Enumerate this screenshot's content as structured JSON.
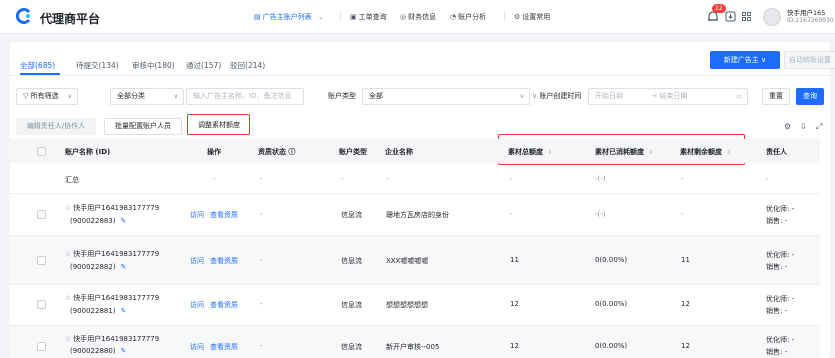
{
  "header": {
    "brand": "代理商平台",
    "nav": [
      {
        "label": "广告主账户列表",
        "icon": "grid-icon",
        "caret": "⌄"
      },
      {
        "label": "工单查询",
        "icon": "ticket-icon"
      },
      {
        "label": "财务信息",
        "icon": "finance-icon"
      },
      {
        "label": "账户分析",
        "icon": "analysis-icon"
      },
      {
        "label": "设置常用",
        "icon": "gear-icon"
      }
    ],
    "badge": "12",
    "user_name": "快手用户165",
    "user_id": "ID:2167369930"
  },
  "tabs": [
    {
      "label": "全部(685)",
      "active": true
    },
    {
      "label": "待提交(134)"
    },
    {
      "label": "审核中(180)"
    },
    {
      "label": "通过(157)"
    },
    {
      "label": "驳回(214)"
    }
  ],
  "actions": {
    "new_advertiser": "新建广告主 ∨",
    "auto_transfer": "自动转账设置"
  },
  "filters": {
    "all_filter": "所有筛选",
    "category": "全部分类",
    "search_placeholder": "输入广告主名称、ID、备注信息",
    "account_type_label": "账户类型",
    "account_type_value": "全部",
    "created_label": "账户创建时间",
    "start_placeholder": "开始日期",
    "end_placeholder": "结束日期",
    "reset": "重置",
    "query": "查询"
  },
  "bulk": {
    "edit_owner": "编辑责任人/协作人",
    "batch_config": "批量配置账户人员",
    "adjust_quota": "调整素材额度"
  },
  "columns": {
    "name": "账户名称 (ID)",
    "ops": "操作",
    "qualification": "资质状态 ⓘ",
    "type": "账户类型",
    "company": "企业名称",
    "total": "素材总额度",
    "used": "素材已消耗额度",
    "remain": "素材剩余额度",
    "owner": "责任人"
  },
  "summary": {
    "label": "汇总",
    "ops": "-",
    "qualification": "-",
    "type": "-",
    "company": "-",
    "total": "-",
    "used": "-(-)",
    "remain": "-",
    "owner": "-"
  },
  "rows": [
    {
      "name": "快手用户1641983177779",
      "id": "(900022883)",
      "ops_visit": "访问",
      "ops_view": "查看资质",
      "qualification": "-",
      "type": "信息流",
      "company": "珊地方瓦房店的身份",
      "total": "-",
      "used": "-(-)",
      "remain": "-",
      "optimizer": "优化师: -",
      "sales": "销售: -"
    },
    {
      "name": "快手用户1641983177779",
      "id": "(900022882)",
      "ops_visit": "访问",
      "ops_view": "查看资质",
      "qualification": "-",
      "type": "信息流",
      "company": "XXX嘘嘘嘘嘘",
      "total": "11",
      "used": "0(0.00%)",
      "remain": "11",
      "optimizer": "优化师: -",
      "sales": "销售: -"
    },
    {
      "name": "快手用户1641983177779",
      "id": "(900022881)",
      "ops_visit": "访问",
      "ops_view": "查看资质",
      "qualification": "-",
      "type": "信息流",
      "company": "想想想想想想",
      "total": "12",
      "used": "0(0.00%)",
      "remain": "12",
      "optimizer": "优化师: -",
      "sales": "销售: -"
    },
    {
      "name": "快手用户1641983177779",
      "id": "(900022880)",
      "ops_visit": "访问",
      "ops_view": "查看资质",
      "qualification": "-",
      "type": "信息流",
      "company": "新开户审核--005",
      "total": "12",
      "used": "0(0.00%)",
      "remain": "12",
      "optimizer": "优化师: -",
      "sales": "销售: -"
    }
  ],
  "colors": {
    "accent": "#1b6cff",
    "highlight": "#e5332a"
  }
}
